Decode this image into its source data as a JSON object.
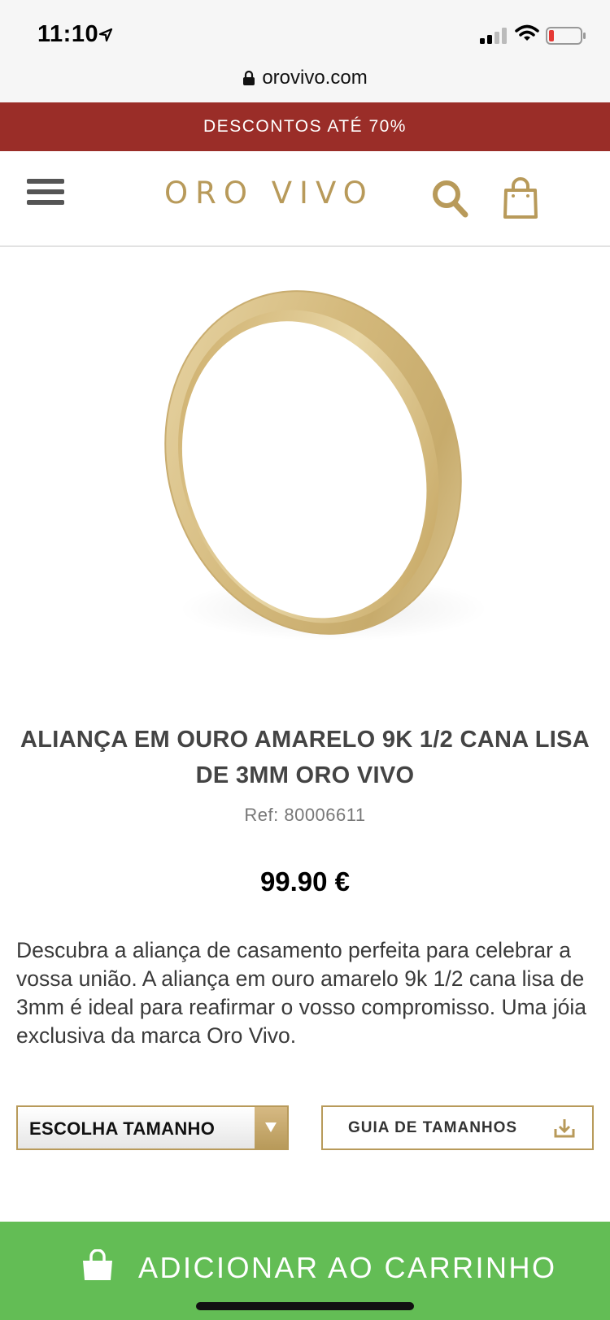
{
  "status_bar": {
    "time": "11:10",
    "icons": [
      "location-arrow-icon",
      "signal-icon",
      "wifi-icon",
      "battery-low-icon"
    ],
    "battery_color": "#e53935"
  },
  "browser": {
    "url": "orovivo.com",
    "lock_icon": "lock-icon"
  },
  "promo_banner": {
    "text": "DESCONTOS ATÉ 70%",
    "color": "#9a2d28"
  },
  "header": {
    "logo": "ORO VIVO",
    "logo_color": "#b89a5a",
    "icons": [
      "menu-icon",
      "search-icon",
      "shopping-bag-icon"
    ]
  },
  "product": {
    "image": "gold-ring-image",
    "title": "ALIANÇA EM OURO AMARELO 9K 1/2 CANA LISA DE 3MM ORO VIVO",
    "ref": "Ref: 80006611",
    "price": "99.90 €",
    "description": "Descubra a aliança de casamento perfeita para celebrar a vossa união. A aliança em ouro amarelo 9k 1/2 cana lisa de 3mm é ideal para reafirmar o vosso compromisso. Uma jóia exclusiva da marca Oro Vivo."
  },
  "size_select": {
    "selected": "ESCOLHA TAMANHO",
    "icon": "chevron-down-icon"
  },
  "size_guide": {
    "label": "GUIA DE TAMANHOS",
    "icon": "download-icon"
  },
  "add_to_cart": {
    "label": "ADICIONAR AO CARRINHO",
    "icon": "shopping-bag-icon",
    "color": "#63bd55"
  }
}
